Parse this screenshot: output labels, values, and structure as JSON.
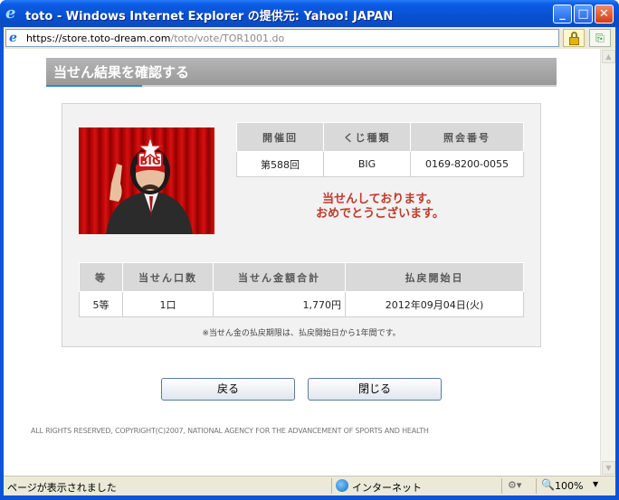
{
  "window": {
    "title": "toto - Windows Internet Explorer の提供元: Yahoo! JAPAN",
    "minimize_glyph": "_",
    "maximize_glyph": "□",
    "close_glyph": "✕"
  },
  "address_bar": {
    "scheme": "https://",
    "host": "store.toto-dream.com",
    "path": "/toto/vote/TOR1001.do"
  },
  "page": {
    "heading": "当せん結果を確認する",
    "lottery_table": {
      "headers": [
        "開催回",
        "くじ種類",
        "照会番号"
      ],
      "row": [
        "第588回",
        "BIG",
        "0169-8200-0055"
      ]
    },
    "message_line1": "当せんしております。",
    "message_line2": "おめでとうございます。",
    "prize_table": {
      "headers": [
        "等",
        "当せん口数",
        "当せん金額合計",
        "払戻開始日"
      ],
      "row": [
        "5等",
        "1口",
        "1,770円",
        "2012年09月04日(火)"
      ]
    },
    "note": "※当せん金の払戻期限は、払戻開始日から1年間です。",
    "buttons": {
      "back": "戻る",
      "close": "閉じる"
    },
    "copyright": "ALL RIGHTS RESERVED, COPYRIGHT(C)2007, NATIONAL AGENCY FOR THE ADVANCEMENT OF SPORTS AND HEALTH",
    "mascot_logo": "BIG"
  },
  "status_bar": {
    "status": "ページが表示されました",
    "zone": "インターネット",
    "zoom": "100%"
  },
  "colors": {
    "accent_blue": "#2a8ad8",
    "message_red": "#c0392b",
    "header_gray": "#d9d9d9"
  }
}
